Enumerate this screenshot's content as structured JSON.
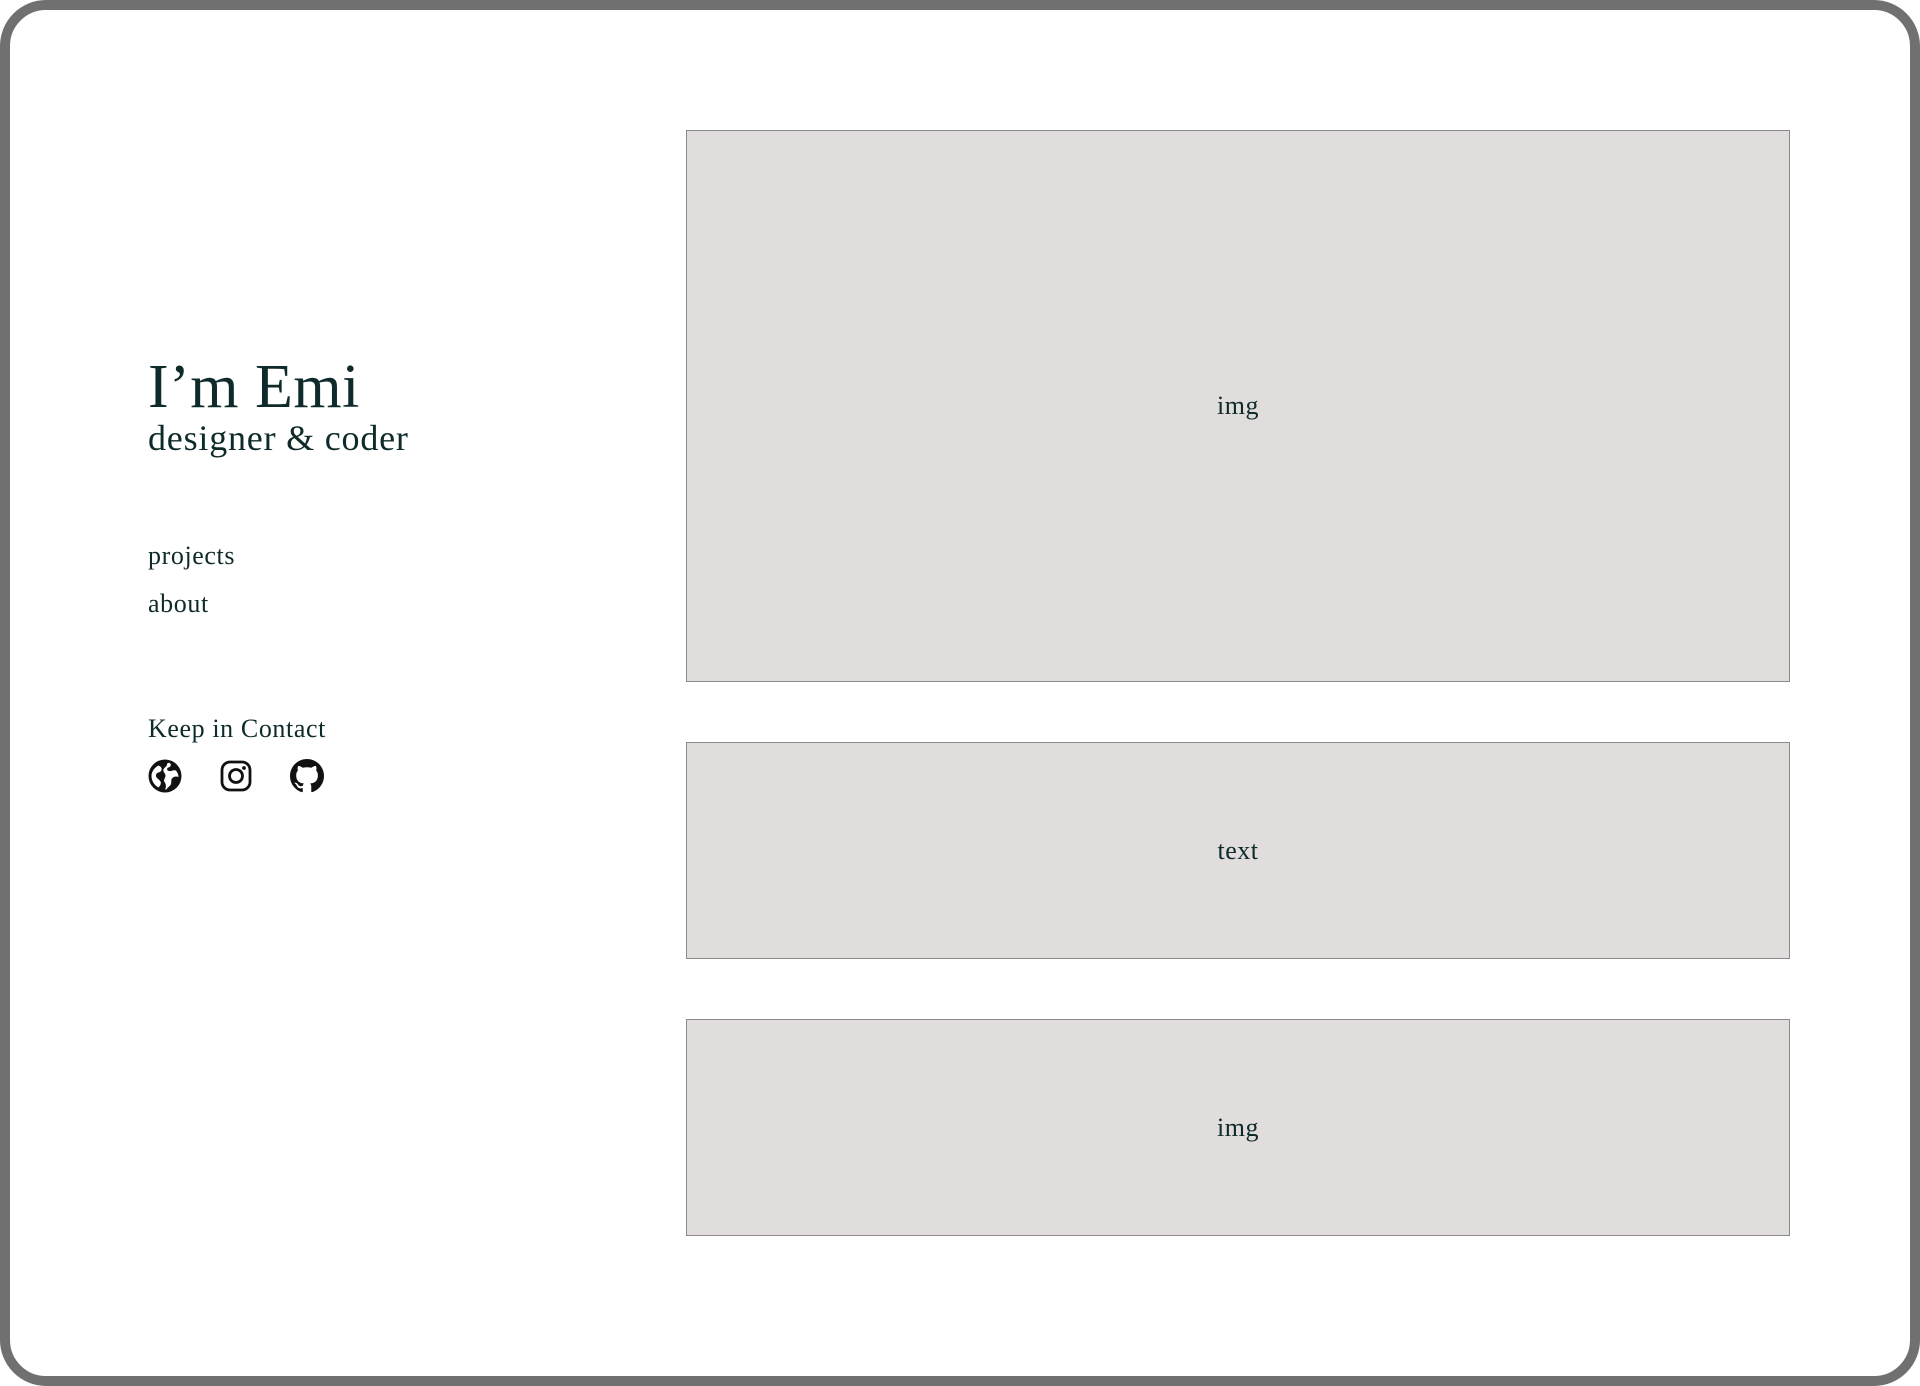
{
  "hero": {
    "title": "I’m Emi",
    "subtitle": "designer & coder"
  },
  "nav": {
    "items": [
      {
        "label": "projects"
      },
      {
        "label": "about"
      }
    ]
  },
  "contact": {
    "heading": "Keep in Contact",
    "icons": [
      "globe-icon",
      "instagram-icon",
      "github-icon"
    ]
  },
  "panels": [
    {
      "label": "img"
    },
    {
      "label": "text"
    },
    {
      "label": "img"
    }
  ],
  "colors": {
    "text": "#0f2a2a",
    "placeholder_bg": "#e0dddc",
    "frame_border": "#707070"
  }
}
